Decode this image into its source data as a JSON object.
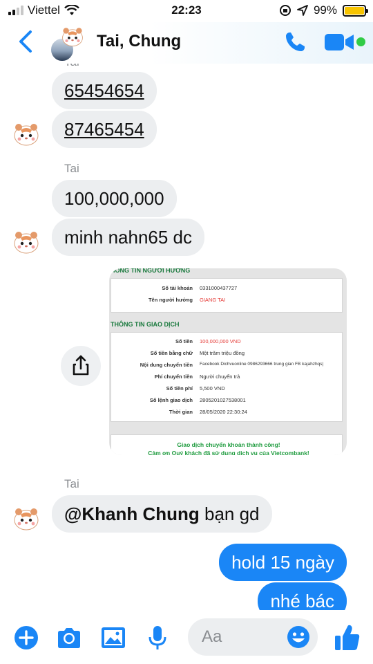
{
  "status_bar": {
    "carrier": "Viettel",
    "time": "22:23",
    "battery_percent": "99%",
    "battery_level": 0.99
  },
  "header": {
    "title": "Tai, Chung"
  },
  "messages": {
    "sender_top_partial": "Tai",
    "msg1": "65454654",
    "msg2": "87465454",
    "sender1": "Tai",
    "msg3": "100,000,000",
    "msg4": "minh nahn65 dc",
    "attachment": {
      "section1_title": "HÔNG TIN NGƯỜI HƯỞNG",
      "account_label": "Số tài khoản",
      "account_value": "0331000437727",
      "beneficiary_label": "Tên người hưởng",
      "beneficiary_value": "GIANG TAI",
      "section2_title": "THÔNG TIN GIAO DỊCH",
      "amount_label": "Số tiền",
      "amount_value": "100,000,000 VND",
      "amount_words_label": "Số tiền bằng chữ",
      "amount_words_value": "Một trăm triệu đồng",
      "content_label": "Nội dung chuyển tiền",
      "content_value": "Facebook Dichvuonline 0986293666 trung gian FB kajahzhqs|",
      "fee_payer_label": "Phí chuyển tiền",
      "fee_payer_value": "Người chuyển trả",
      "fee_label": "Số tiền phí",
      "fee_value": "5,500 VND",
      "ref_label": "Số lệnh giao dịch",
      "ref_value": "2805201027538001",
      "time_label": "Thời gian",
      "time_value": "28/05/2020 22:30:24",
      "success_line1": "Giao dịch chuyển khoản thành công!",
      "success_line2": "Cảm ơn Quý khách đã sử dụng dịch vụ của Vietcombank!"
    },
    "sender2": "Tai",
    "msg5_mention": "@Khanh Chung",
    "msg5_text": " bạn gd",
    "out1": "hold 15 ngày",
    "out2": "nhé bác"
  },
  "composer": {
    "placeholder": "Aa"
  },
  "colors": {
    "accent": "#1a86f6",
    "incoming_bubble": "#eceef0",
    "online": "#31cc46"
  },
  "icons": [
    "signal-icon",
    "wifi-icon",
    "orientation-lock-icon",
    "location-icon",
    "battery-icon",
    "back-chevron-icon",
    "phone-icon",
    "video-icon",
    "share-icon",
    "plus-icon",
    "camera-icon",
    "gallery-icon",
    "mic-icon",
    "emoji-icon",
    "like-icon"
  ]
}
